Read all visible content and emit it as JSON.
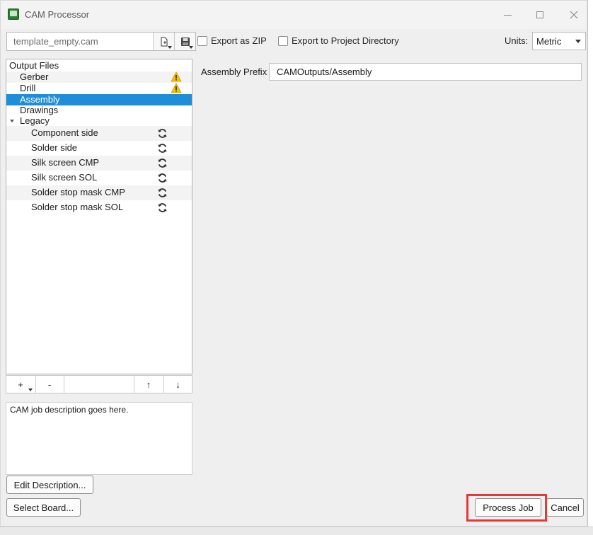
{
  "window": {
    "title": "CAM Processor"
  },
  "toolbar": {
    "template_file": "template_empty.cam",
    "export_zip_label": "Export as ZIP",
    "export_project_label": "Export to Project Directory",
    "units_label": "Units:",
    "units_value": "Metric"
  },
  "tree": {
    "root": "Output Files",
    "items": [
      {
        "label": "Gerber"
      },
      {
        "label": "Drill"
      },
      {
        "label": "Assembly"
      },
      {
        "label": "Drawings"
      },
      {
        "label": "Legacy"
      }
    ],
    "legacy": [
      {
        "label": "Component side"
      },
      {
        "label": "Solder side"
      },
      {
        "label": "Silk screen CMP"
      },
      {
        "label": "Silk screen SOL"
      },
      {
        "label": "Solder stop mask CMP"
      },
      {
        "label": "Solder stop mask SOL"
      }
    ],
    "buttons": {
      "add": "+",
      "remove": "-",
      "up": "↑",
      "down": "↓"
    }
  },
  "description": "CAM job description goes here.",
  "buttons": {
    "edit_description": "Edit Description...",
    "select_board": "Select Board...",
    "process_job": "Process Job",
    "cancel": "Cancel"
  },
  "assembly": {
    "prefix_label": "Assembly Prefix",
    "prefix_value": "CAMOutputs/Assembly"
  },
  "colors": {
    "selection": "#1f8ed6",
    "warning": "#f5c400",
    "highlight": "#e53935"
  }
}
